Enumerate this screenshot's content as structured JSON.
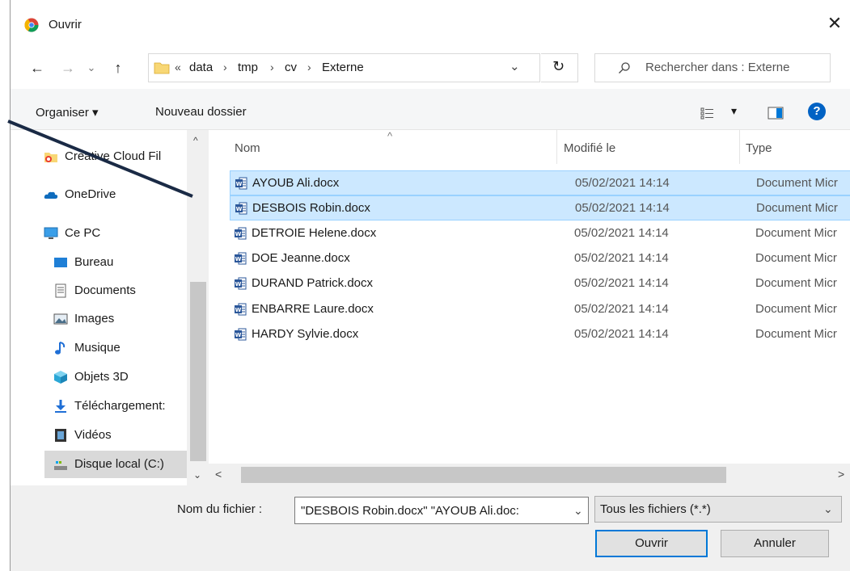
{
  "window": {
    "title": "Ouvrir",
    "close_symbol": "✕"
  },
  "nav": {
    "back": "←",
    "forward": "→",
    "recent": "⌄",
    "up": "↑",
    "breadcrumb_overflow": "«",
    "breadcrumb": [
      "data",
      "tmp",
      "cv",
      "Externe"
    ],
    "separator": "›",
    "dropdown": "⌄",
    "refresh": "↻",
    "search_placeholder": "Rechercher dans : Externe"
  },
  "toolbar": {
    "organize": "Organiser ▾",
    "new_folder": "Nouveau dossier",
    "view_symbol": "▾",
    "help": "?"
  },
  "sidebar": {
    "items": [
      {
        "label": "Creative Cloud Fil",
        "icon": "creative-cloud-icon"
      },
      {
        "label": "OneDrive",
        "icon": "onedrive-icon"
      },
      {
        "label": "Ce PC",
        "icon": "computer-icon"
      },
      {
        "label": "Bureau",
        "icon": "desktop-icon"
      },
      {
        "label": "Documents",
        "icon": "documents-icon"
      },
      {
        "label": "Images",
        "icon": "images-icon"
      },
      {
        "label": "Musique",
        "icon": "music-icon"
      },
      {
        "label": "Objets 3D",
        "icon": "objects3d-icon"
      },
      {
        "label": "Téléchargement:",
        "icon": "download-icon"
      },
      {
        "label": "Vidéos",
        "icon": "videos-icon"
      },
      {
        "label": "Disque local (C:)",
        "icon": "drive-icon"
      }
    ]
  },
  "columns": {
    "name": "Nom",
    "modified": "Modifié le",
    "type": "Type",
    "sort_arrow": "^"
  },
  "files": [
    {
      "name": "AYOUB Ali.docx",
      "date": "05/02/2021 14:14",
      "type": "Document Micr",
      "selected": true
    },
    {
      "name": "DESBOIS Robin.docx",
      "date": "05/02/2021 14:14",
      "type": "Document Micr",
      "selected": true
    },
    {
      "name": "DETROIE Helene.docx",
      "date": "05/02/2021 14:14",
      "type": "Document Micr",
      "selected": false
    },
    {
      "name": "DOE Jeanne.docx",
      "date": "05/02/2021 14:14",
      "type": "Document Micr",
      "selected": false
    },
    {
      "name": "DURAND Patrick.docx",
      "date": "05/02/2021 14:14",
      "type": "Document Micr",
      "selected": false
    },
    {
      "name": "ENBARRE Laure.docx",
      "date": "05/02/2021 14:14",
      "type": "Document Micr",
      "selected": false
    },
    {
      "name": "HARDY Sylvie.docx",
      "date": "05/02/2021 14:14",
      "type": "Document Micr",
      "selected": false
    }
  ],
  "footer": {
    "filename_label": "Nom du fichier :",
    "filename_value": "\"DESBOIS Robin.docx\" \"AYOUB Ali.doc:",
    "filter_value": "Tous les fichiers (*.*)",
    "open_label": "Ouvrir",
    "cancel_label": "Annuler"
  },
  "scroll": {
    "left": "<",
    "right": ">",
    "up": "^",
    "down": "⌄"
  },
  "colors": {
    "selection": "#cce8ff",
    "selection_border": "#99d1ff",
    "accent": "#0078d7",
    "word_blue": "#2b579a",
    "folder_yellow": "#f8d775"
  }
}
